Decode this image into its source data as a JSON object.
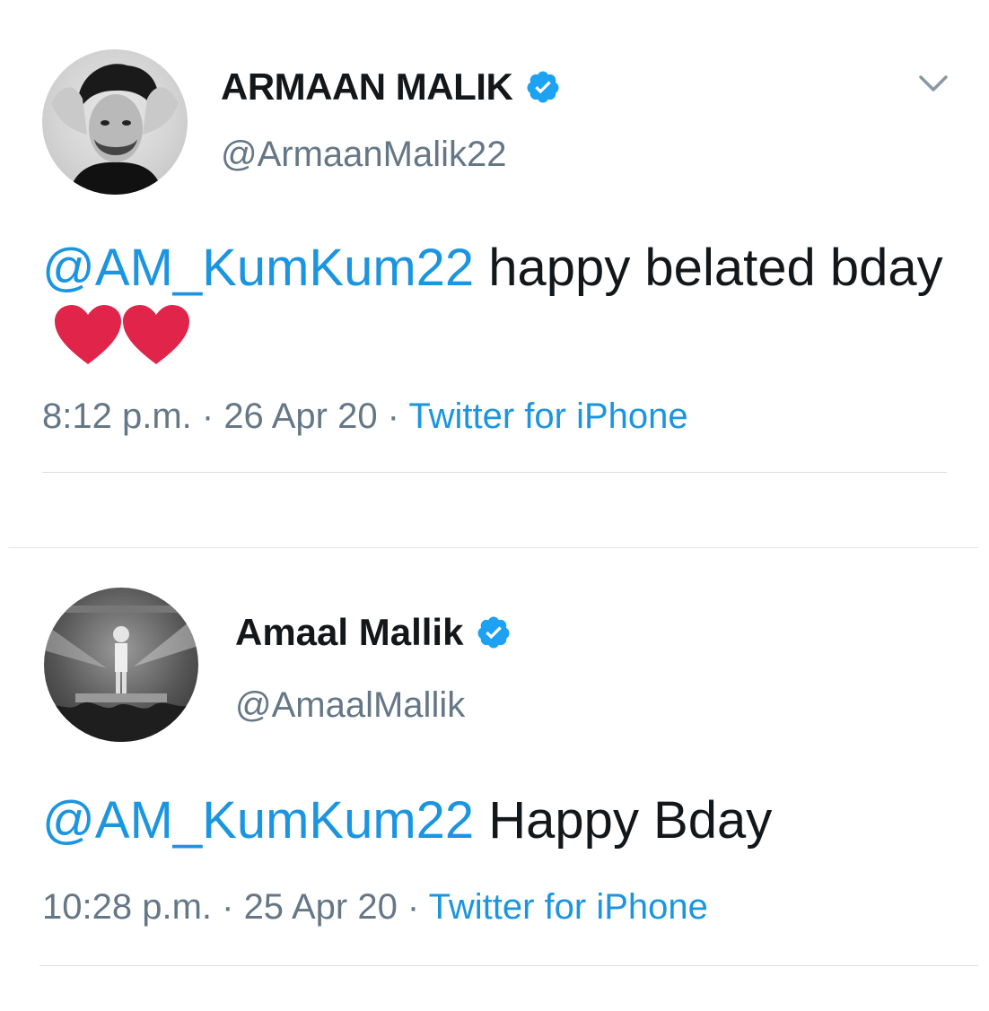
{
  "tweets": [
    {
      "display_name": "ARMAAN MALIK",
      "handle": "@ArmaanMalik22",
      "mention": "@AM_KumKum22",
      "text": " happy belated bday",
      "time": "8:12 p.m.",
      "date": "26 Apr 20",
      "source": "Twitter for iPhone",
      "separator": " · ",
      "avatar_icon": "avatar-portrait",
      "verified_icon": "verified-badge-icon",
      "menu_icon": "chevron-down-icon",
      "emoji": "heart-emoji x2"
    },
    {
      "display_name": "Amaal Mallik",
      "handle": "@AmaalMallik",
      "mention": "@AM_KumKum22",
      "text": " Happy Bday",
      "time": "10:28 p.m.",
      "date": "25 Apr 20",
      "source": "Twitter for iPhone",
      "separator": " · ",
      "avatar_icon": "avatar-concert-photo",
      "verified_icon": "verified-badge-icon"
    }
  ],
  "colors": {
    "link": "#1b95e0",
    "text": "#14171a",
    "secondary": "#657786",
    "verified": "#1da1f2",
    "heart": "#e0244a",
    "divider": "#d9dde1"
  }
}
